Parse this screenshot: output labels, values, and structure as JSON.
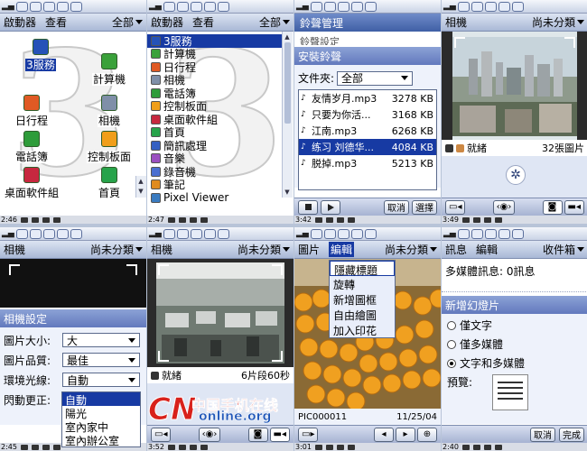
{
  "status_icons": [
    "antenna-icon",
    "envelope-icon",
    "phone-icon",
    "camera-icon",
    "window-icon",
    "cube-icon"
  ],
  "bottom_status_icons": [
    "keyboard-icon",
    "bluetooth-icon",
    "sound-icon",
    "antenna-icon"
  ],
  "panels": {
    "p1": {
      "time": "2:46",
      "menu": {
        "left1": "啟動器",
        "left2": "查看",
        "right": "全部"
      },
      "big_glyph": "3",
      "launcher_items": [
        {
          "label": "3服務",
          "icon": "three-service-icon",
          "color": "#2552b8",
          "selected": true
        },
        {
          "label": "計算機",
          "icon": "calculator-icon",
          "color": "#3aa13a",
          "selected": false
        },
        {
          "label": "日行程",
          "icon": "calendar-icon",
          "color": "#e05a24",
          "selected": false
        },
        {
          "label": "相機",
          "icon": "camera-icon",
          "color": "#7f8fa8",
          "selected": false
        },
        {
          "label": "電話簿",
          "icon": "phonebook-icon",
          "color": "#2e9c3a",
          "selected": false
        },
        {
          "label": "控制板面",
          "icon": "control-panel-icon",
          "color": "#f09e1a",
          "selected": false
        },
        {
          "label": "桌面軟件組",
          "icon": "desktop-suite-icon",
          "color": "#c7283f",
          "selected": false
        },
        {
          "label": "首頁",
          "icon": "home-icon",
          "color": "#27a34a",
          "selected": false
        }
      ]
    },
    "p2": {
      "time": "2:47",
      "menu": {
        "left1": "啟動器",
        "left2": "查看",
        "right": "全部"
      },
      "big_glyph": "3",
      "list_items": [
        "3服務",
        "計算機",
        "日行程",
        "相機",
        "電話簿",
        "控制板面",
        "桌面軟件組",
        "首頁",
        "簡訊處理",
        "音樂",
        "錄音機",
        "筆記",
        "Pixel Viewer"
      ],
      "list_colors": [
        "#2552b8",
        "#3aa13a",
        "#e05a24",
        "#7f8fa8",
        "#2e9c3a",
        "#f09e1a",
        "#c7283f",
        "#27a34a",
        "#3560c2",
        "#9b4fc0",
        "#4a6fd1",
        "#e08b1f",
        "#3a7bc0"
      ]
    },
    "p3": {
      "time": "3:42",
      "title": "鈴聲管理",
      "behind_text": "鈴聲設定",
      "dialog_title": "安裝鈴聲",
      "folder_label": "文件夾:",
      "folder_value": "全部",
      "files": [
        {
          "name": "友情岁月.mp3",
          "size": "3278 KB",
          "selected": false
        },
        {
          "name": "只要为你活...",
          "size": "3168 KB",
          "selected": false
        },
        {
          "name": "江南.mp3",
          "size": "6268 KB",
          "selected": false
        },
        {
          "name": "练习 刘德华...",
          "size": "4084 KB",
          "selected": true
        },
        {
          "name": "脱掉.mp3",
          "size": "5213 KB",
          "selected": false
        }
      ],
      "cancel": "取消",
      "select": "選擇"
    },
    "p4": {
      "time": "3:49",
      "menu": {
        "left": "相機",
        "right": "尚未分類"
      },
      "ready": "就緒",
      "count": "32張圖片"
    },
    "p5": {
      "time": "2:45",
      "menu": {
        "left": "相機",
        "right": "尚未分類"
      },
      "settings_title": "相機設定",
      "rows": [
        {
          "label": "圖片大小:",
          "value": "大"
        },
        {
          "label": "圖片品質:",
          "value": "最佳"
        },
        {
          "label": "環境光線:",
          "value": "自動"
        },
        {
          "label": "閃動更正:",
          "value": ""
        }
      ],
      "light_options": [
        "自動",
        "陽光",
        "室內家中",
        "室內辦公室"
      ]
    },
    "p6": {
      "time": "3:52",
      "menu": {
        "left": "相機",
        "right": "尚未分類"
      },
      "ready": "就緒",
      "remaining": "6片段60秒"
    },
    "p7": {
      "time": "3:01",
      "menu": {
        "left1": "圖片",
        "left2": "編輯",
        "right": "尚未分類"
      },
      "popup": [
        "隱藏標題",
        "旋轉",
        "新增圖框",
        "自由繪圖",
        "加入印花"
      ],
      "filename": "PIC000011",
      "date": "11/25/04"
    },
    "p8": {
      "time": "2:40",
      "menu": {
        "left1": "訊息",
        "left2": "編輯",
        "right": "收件箱"
      },
      "mms_line": "多媒體訊息: 0訊息",
      "dialog_title": "新增幻燈片",
      "options": [
        {
          "label": "僅文字",
          "on": false
        },
        {
          "label": "僅多媒體",
          "on": false
        },
        {
          "label": "文字和多媒體",
          "on": true
        }
      ],
      "preview": "預覽:",
      "cancel": "取消",
      "done": "完成"
    }
  },
  "watermark": {
    "cn": "CN",
    "site_cn": "中国手机在线",
    "site_en": "online.org",
    "colors": {
      "red": "#d8211b",
      "blue": "#1f56b8"
    }
  }
}
